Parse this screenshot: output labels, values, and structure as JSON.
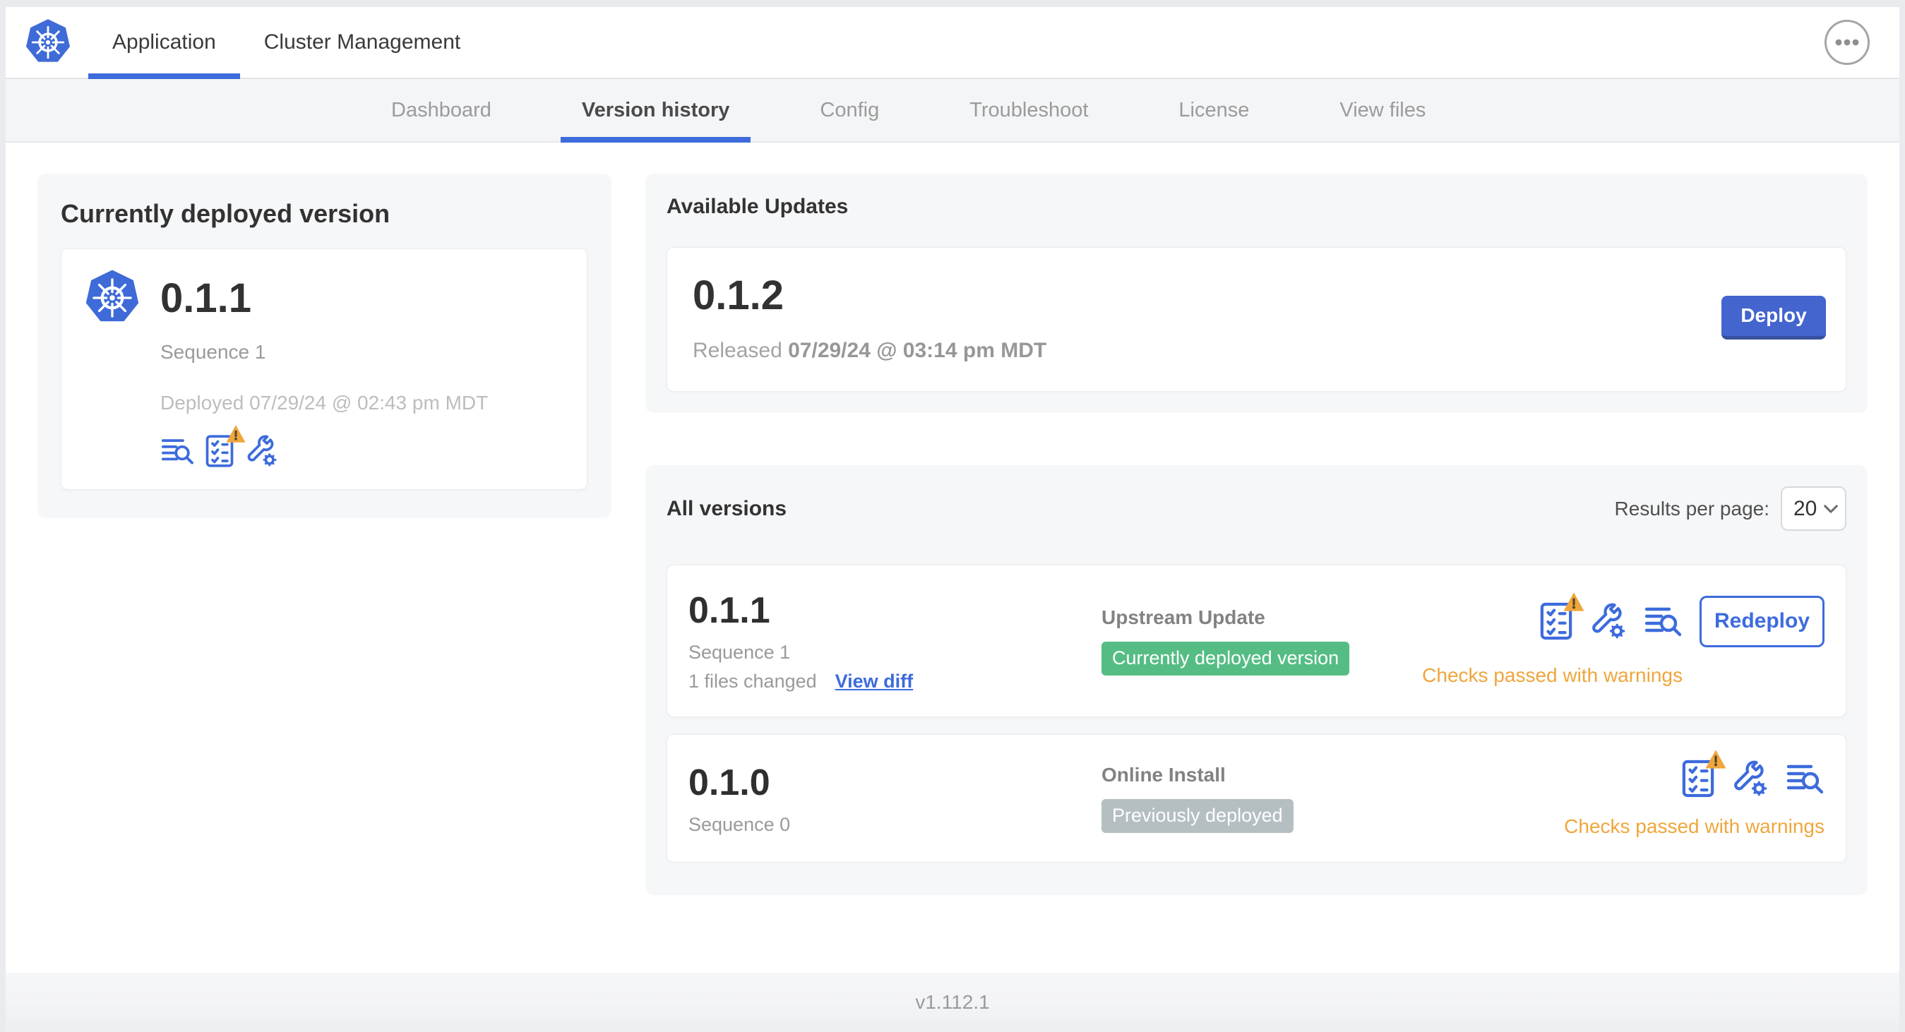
{
  "header": {
    "logo": "kubernetes-logo",
    "tabs": [
      {
        "label": "Application",
        "active": true
      },
      {
        "label": "Cluster Management",
        "active": false
      }
    ],
    "menu_icon": "ellipsis-icon"
  },
  "subnav": {
    "tabs": [
      {
        "label": "Dashboard",
        "active": false
      },
      {
        "label": "Version history",
        "active": true
      },
      {
        "label": "Config",
        "active": false
      },
      {
        "label": "Troubleshoot",
        "active": false
      },
      {
        "label": "License",
        "active": false
      },
      {
        "label": "View files",
        "active": false
      }
    ]
  },
  "current_version": {
    "title": "Currently deployed version",
    "version": "0.1.1",
    "sequence": "Sequence 1",
    "deployed": "Deployed 07/29/24 @ 02:43 pm MDT",
    "icons": [
      "deploy-logs-icon",
      "preflight-checks-warning-icon",
      "config-icon"
    ]
  },
  "available_updates": {
    "title": "Available Updates",
    "version": "0.1.2",
    "released_label": "Released",
    "released_date": "07/29/24 @ 03:14 pm MDT",
    "deploy_button": "Deploy"
  },
  "all_versions": {
    "title": "All versions",
    "results_per_page_label": "Results per page:",
    "results_per_page_value": "20",
    "rows": [
      {
        "version": "0.1.1",
        "sequence": "Sequence 1",
        "files_changed": "1 files changed",
        "view_diff_label": "View diff",
        "source": "Upstream Update",
        "badge": {
          "label": "Currently deployed version",
          "color": "#55BD84"
        },
        "icons": [
          "preflight-checks-warning-icon",
          "config-icon",
          "deploy-logs-icon"
        ],
        "status": "Checks passed with warnings",
        "action_label": "Redeploy"
      },
      {
        "version": "0.1.0",
        "sequence": "Sequence 0",
        "source": "Online Install",
        "badge": {
          "label": "Previously deployed",
          "color": "#B5BFC2"
        },
        "icons": [
          "preflight-checks-warning-icon",
          "config-icon",
          "deploy-logs-icon"
        ],
        "status": "Checks passed with warnings"
      }
    ]
  },
  "footer": {
    "app_version": "v1.112.1"
  },
  "colors": {
    "accent_blue": "#3D6BDC",
    "deploy_button_blue": "#4464CE",
    "badge_green": "#55BD84",
    "badge_gray": "#B5BFC2",
    "warning_amber": "#EFA63C",
    "nav_background": "#F4F5F7",
    "card_background": "#F6F7F9",
    "logo_blue": "#3E6BD7"
  }
}
